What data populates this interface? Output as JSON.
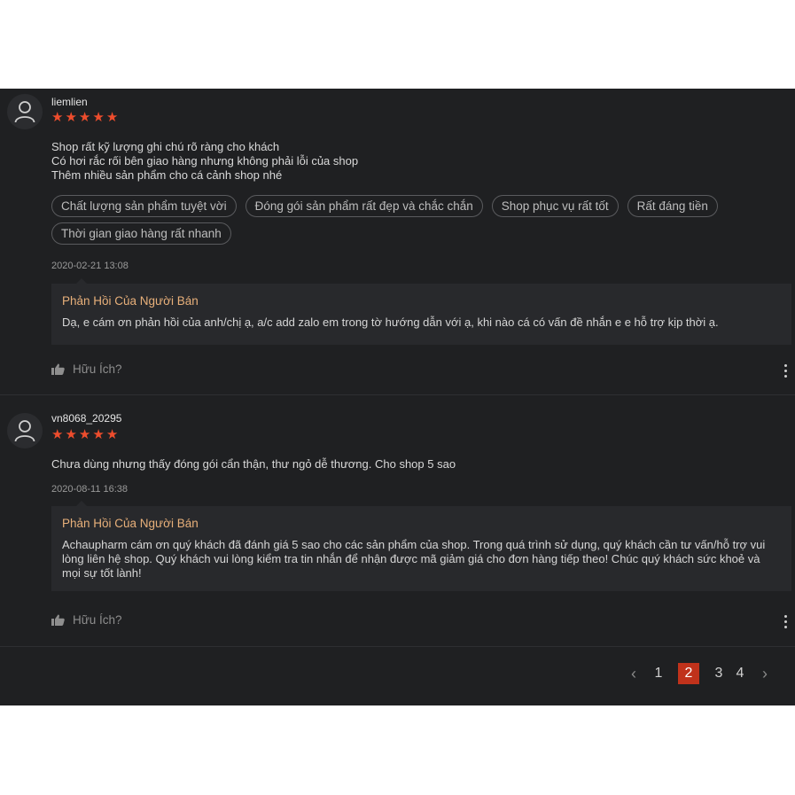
{
  "reviews": [
    {
      "author": "liemlien",
      "rating": 5,
      "text": "Shop rất kỹ lượng ghi chú rõ ràng cho khách\nCó hơi rắc rối bên giao hàng nhưng không phải lỗi của shop\nThêm nhiều sản phẩm cho cá cảnh shop nhé",
      "tags": [
        "Chất lượng sản phẩm tuyệt vời",
        "Đóng gói sản phẩm rất đẹp và chắc chắn",
        "Shop phục vụ rất tốt",
        "Rất đáng tiền",
        "Thời gian giao hàng rất nhanh"
      ],
      "date": "2020-02-21 13:08",
      "reply_title": "Phản Hồi Của Người Bán",
      "reply_text": "Dạ, e cám ơn phản hồi của anh/chị ạ, a/c add zalo em trong tờ hướng dẫn với ạ, khi nào cá có vấn đề nhắn e e hỗ trợ kịp thời ạ.",
      "helpful_label": "Hữu Ích?"
    },
    {
      "author": "vn8068_20295",
      "rating": 5,
      "text": "Chưa dùng nhưng thấy đóng gói cẩn thận, thư ngỏ dễ thương. Cho shop 5 sao",
      "date": "2020-08-11 16:38",
      "reply_title": "Phản Hồi Của Người Bán",
      "reply_text": "Achaupharm cám ơn quý khách đã đánh giá 5 sao cho các sản phẩm của shop. Trong quá trình sử dụng, quý khách cần tư vấn/hỗ trợ vui lòng liên hệ shop. Quý khách vui lòng kiểm tra tin nhắn để nhận được mã giảm giá cho đơn hàng tiếp theo! Chúc quý khách sức khoẻ và mọi sự tốt lành!",
      "helpful_label": "Hữu Ích?"
    }
  ],
  "pagination": {
    "prev_icon": "chevron-left-icon",
    "next_icon": "chevron-right-icon",
    "pages": [
      "1",
      "2",
      "3",
      "4"
    ],
    "current": "2"
  },
  "colors": {
    "background": "#1f2022",
    "star": "#ee4d2d",
    "reply_title": "#e8b07a",
    "active_page": "#c0321b"
  }
}
